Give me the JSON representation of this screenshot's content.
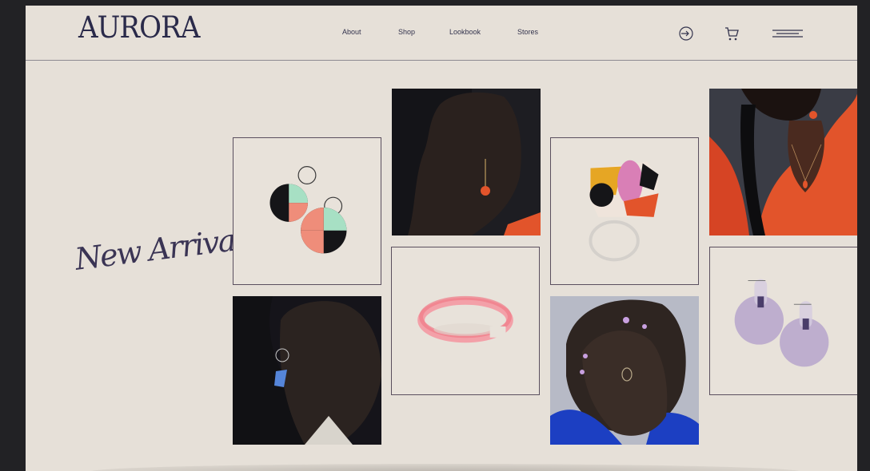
{
  "header": {
    "logo": "AURORA",
    "nav": [
      "About",
      "Shop",
      "Lookbook",
      "Stores"
    ]
  },
  "icons": {
    "login": "login-icon",
    "cart": "cart-icon",
    "menu": "hamburger-menu-icon"
  },
  "main": {
    "heading": "New Arrivals"
  },
  "colors": {
    "background": "#e6e0d8",
    "frame": "#5a4f5e",
    "text": "#2a2a4a",
    "accent_orange": "#e2542b",
    "accent_pink": "#f07a88",
    "accent_lilac": "#b9a8cc"
  },
  "gallery": [
    {
      "name": "product-earrings-color-block"
    },
    {
      "name": "model-profile-red-earring"
    },
    {
      "name": "product-acrylic-ring"
    },
    {
      "name": "model-orange-shirt"
    },
    {
      "name": "model-blue-earring"
    },
    {
      "name": "product-pink-bangle"
    },
    {
      "name": "model-hand-face"
    },
    {
      "name": "product-lilac-disc-earrings"
    }
  ]
}
